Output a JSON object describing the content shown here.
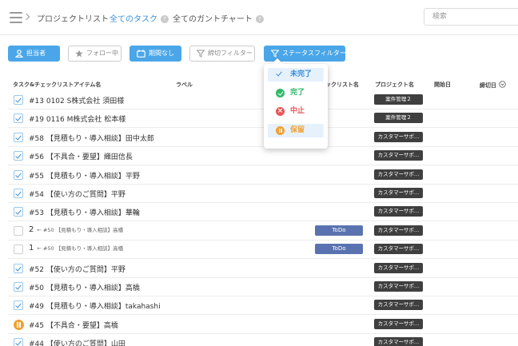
{
  "nav": {
    "tabs": [
      {
        "label": "プロジェクトリスト"
      },
      {
        "label": "全てのタスク",
        "help": "?"
      },
      {
        "label": "全てのガントチャート",
        "help": "?"
      }
    ],
    "search_placeholder": "検索"
  },
  "filters": {
    "assignee": "担当者",
    "following": "フォロー中",
    "no_period": "期間なし",
    "deadline_filter": "締切フィルター",
    "status_filter": "ステータスフィルター"
  },
  "status_menu": {
    "items": [
      {
        "label": "未完了",
        "color": "#3a8fd8",
        "icon": "check-icon",
        "selected": true
      },
      {
        "label": "完了",
        "color": "#2fb86a",
        "icon": "check-circle-icon",
        "selected": false
      },
      {
        "label": "中止",
        "color": "#e85656",
        "icon": "cancel-circle-icon",
        "selected": false
      },
      {
        "label": "保留",
        "color": "#f0a030",
        "icon": "pause-circle-icon",
        "selected": true
      }
    ]
  },
  "table": {
    "headers": {
      "task": "タスク&チェックリストアイテム名",
      "label": "ラベル",
      "checklist": "ックリスト名",
      "project": "プロジェクト名",
      "start": "開始日",
      "deadline": "締切日"
    },
    "rows": [
      {
        "title": "#13 0102 S株式会社 須田様",
        "status": "check",
        "project": "案件管理２"
      },
      {
        "title": "#19 0116 M株式会社 松本様",
        "status": "check",
        "project": "案件管理２"
      },
      {
        "title": "#58 【見積もり・導入相談】田中太郎",
        "status": "check",
        "project": "カスタマーサポ…"
      },
      {
        "title": "#56 【不具合・要望】織田信長",
        "status": "check",
        "project": "カスタマーサポ…"
      },
      {
        "title": "#55 【見積もり・導入相談】平野",
        "status": "check",
        "project": "カスタマーサポ…"
      },
      {
        "title": "#54 【使い方のご質問】平野",
        "status": "check",
        "project": "カスタマーサポ…"
      },
      {
        "title": "#53 【見積もり・導入相談】華輪",
        "status": "check",
        "project": "カスタマーサポ…"
      },
      {
        "title": "2",
        "parent": "← #50 【見積もり・導入相談】高橋",
        "status": "empty",
        "checklist": "ToDo",
        "project": "カスタマーサポ…"
      },
      {
        "title": "1",
        "parent": "← #50 【見積もり・導入相談】高橋",
        "status": "empty",
        "checklist": "ToDo",
        "project": "カスタマーサポ…"
      },
      {
        "title": "#52 【使い方のご質問】平野",
        "status": "check",
        "project": "カスタマーサポ…"
      },
      {
        "title": "#50 【見積もり・導入相談】高橋",
        "status": "check",
        "project": "カスタマーサポ…"
      },
      {
        "title": "#49 【見積もり・導入相談】takahashi",
        "status": "check",
        "project": "カスタマーサポ…"
      },
      {
        "title": "#45 【不具合・要望】高橋",
        "status": "pause",
        "project": "カスタマーサポ…"
      },
      {
        "title": "#44 【使い方のご質問】山田",
        "status": "check",
        "project": "カスタマーサポ…"
      }
    ]
  }
}
